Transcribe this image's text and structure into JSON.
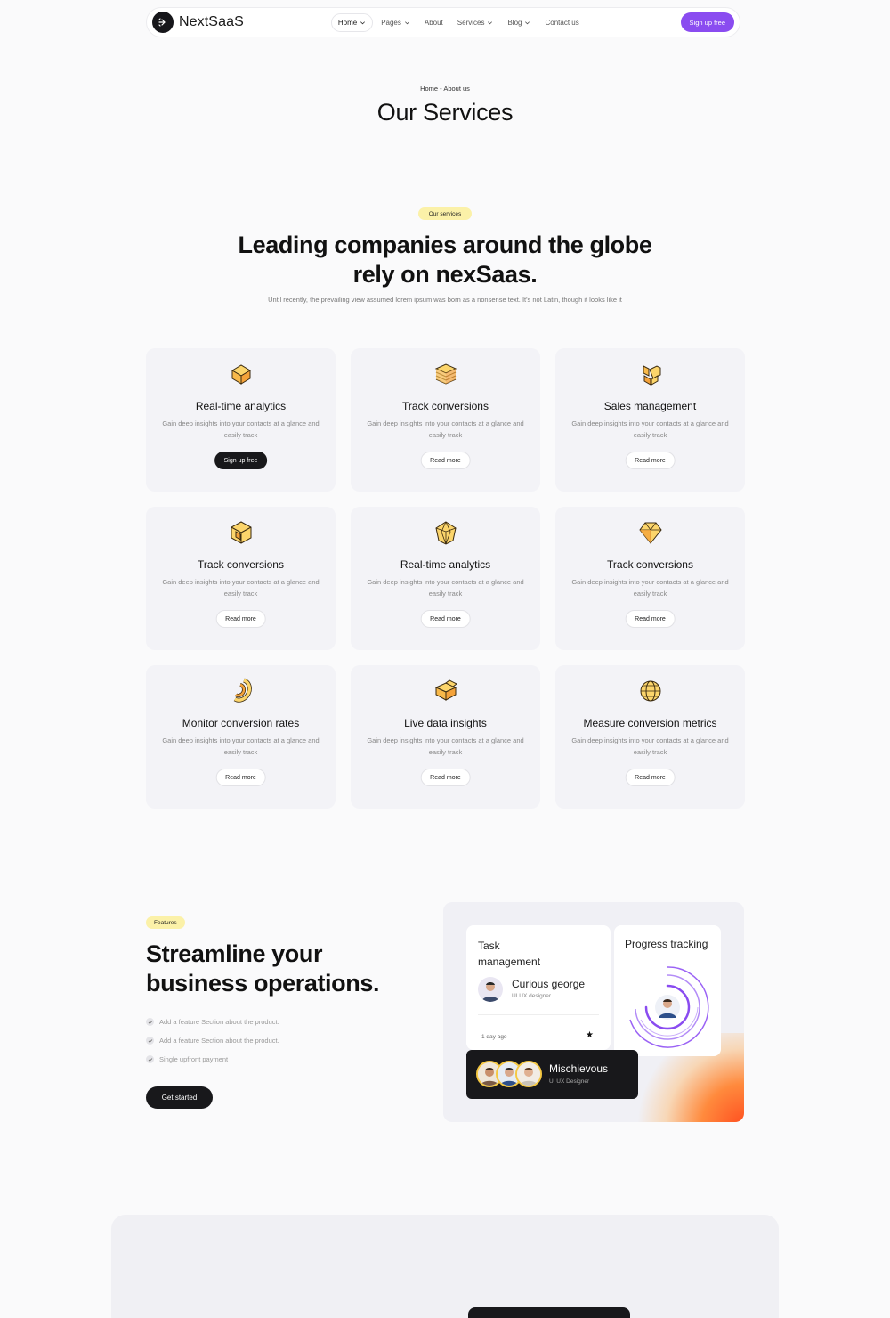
{
  "nav": {
    "brand": "NextSaaS",
    "items": [
      {
        "label": "Home",
        "dropdown": true,
        "active": true
      },
      {
        "label": "Pages",
        "dropdown": true
      },
      {
        "label": "About",
        "dropdown": false
      },
      {
        "label": "Services",
        "dropdown": true
      },
      {
        "label": "Blog",
        "dropdown": true
      },
      {
        "label": "Contact us",
        "dropdown": false
      }
    ],
    "signup_label": "Sign up free",
    "accent": "#8a4cf0"
  },
  "hero": {
    "breadcrumb": "Home - About us",
    "title": "Our Services"
  },
  "services": {
    "badge": "Our services",
    "heading": "Leading companies around the globe rely on nexSaas.",
    "subtext": "Until recently, the prevailing view assumed lorem ipsum was born as a nonsense text. It's not Latin, though it looks like it",
    "cards": [
      {
        "title": "Real-time analytics",
        "desc": "Gain deep insights into your contacts at a glance and easily track",
        "button": "Sign up free",
        "primary": true,
        "icon": "box-icon"
      },
      {
        "title": "Track conversions",
        "desc": "Gain deep insights into your contacts at a glance and easily track",
        "button": "Read more",
        "primary": false,
        "icon": "stack-icon"
      },
      {
        "title": "Sales management",
        "desc": "Gain deep insights into your contacts at a glance and easily track",
        "button": "Read more",
        "primary": false,
        "icon": "blocks-icon"
      },
      {
        "title": "Track conversions",
        "desc": "Gain deep insights into your contacts at a glance and easily track",
        "button": "Read more",
        "primary": false,
        "icon": "cube-icon"
      },
      {
        "title": "Real-time analytics",
        "desc": "Gain deep insights into your contacts at a glance and easily track",
        "button": "Read more",
        "primary": false,
        "icon": "polyhedron-icon"
      },
      {
        "title": "Track conversions",
        "desc": "Gain deep insights into your contacts at a glance and easily track",
        "button": "Read more",
        "primary": false,
        "icon": "gem-icon"
      },
      {
        "title": "Monitor conversion rates",
        "desc": "Gain deep insights into your contacts at a glance and easily track",
        "button": "Read more",
        "primary": false,
        "icon": "spiral-icon"
      },
      {
        "title": "Live data insights",
        "desc": "Gain deep insights into your contacts at a glance and easily track",
        "button": "Read more",
        "primary": false,
        "icon": "open-box-icon"
      },
      {
        "title": "Measure conversion metrics",
        "desc": "Gain deep insights into your contacts at a glance and easily track",
        "button": "Read more",
        "primary": false,
        "icon": "globe-icon"
      }
    ]
  },
  "features": {
    "badge": "Features",
    "heading": "Streamline your business operations.",
    "items": [
      "Add a feature Section about the product.",
      "Add a feature Section about the product.",
      "Single upfront payment"
    ],
    "cta": "Get started",
    "task_card": {
      "title": "Task management",
      "name": "Curious george",
      "role": "UI UX designer",
      "time": "1 day ago"
    },
    "progress_card": {
      "title": "Progress tracking"
    },
    "team_card": {
      "name": "Mischievous",
      "role": "UI UX Designer"
    }
  }
}
